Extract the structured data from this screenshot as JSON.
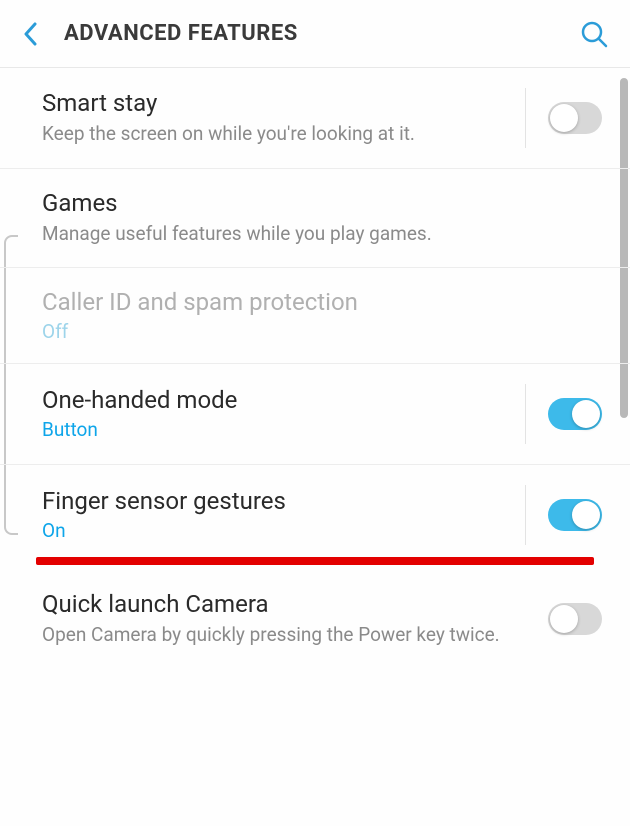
{
  "header": {
    "title": "ADVANCED FEATURES"
  },
  "rows": {
    "smartStay": {
      "title": "Smart stay",
      "desc": "Keep the screen on while you're looking at it."
    },
    "games": {
      "title": "Games",
      "desc": "Manage useful features while you play games."
    },
    "callerId": {
      "title": "Caller ID and spam protection",
      "status": "Off"
    },
    "oneHanded": {
      "title": "One-handed mode",
      "status": "Button"
    },
    "fingerSensor": {
      "title": "Finger sensor gestures",
      "status": "On"
    },
    "quickCamera": {
      "title": "Quick launch Camera",
      "desc": "Open Camera by quickly pressing the Power key twice."
    }
  }
}
